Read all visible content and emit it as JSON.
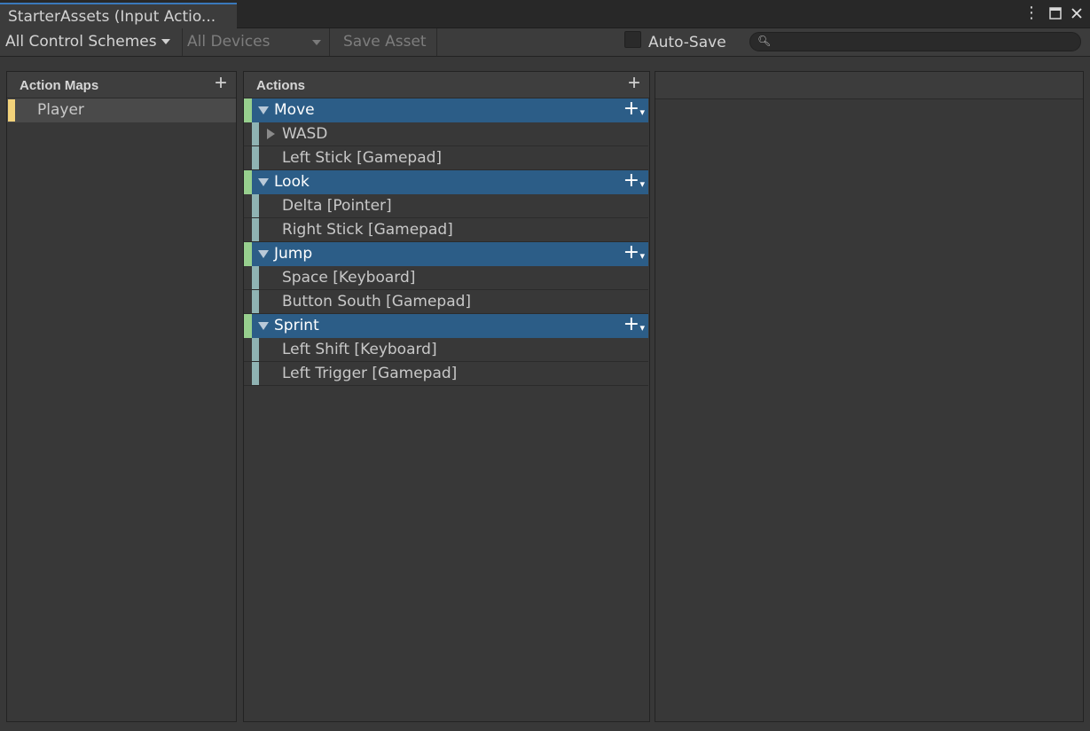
{
  "window": {
    "tab_title": "StarterAssets (Input Actio...",
    "menu_icon": "more-vertical-icon",
    "maximize_icon": "maximize-icon",
    "close_icon": "close-icon"
  },
  "toolbar": {
    "control_schemes": "All Control Schemes",
    "devices": "All Devices",
    "save_asset": "Save Asset",
    "auto_save_label": "Auto-Save",
    "auto_save_checked": false,
    "search_value": "",
    "search_icon": "search-icon"
  },
  "action_maps": {
    "header": "Action Maps",
    "items": [
      {
        "label": "Player",
        "selected": true
      }
    ]
  },
  "actions": {
    "header": "Actions",
    "items": [
      {
        "label": "Move",
        "bindings": [
          {
            "label": "WASD",
            "composite": true
          },
          {
            "label": "Left Stick [Gamepad]"
          }
        ]
      },
      {
        "label": "Look",
        "bindings": [
          {
            "label": "Delta [Pointer]"
          },
          {
            "label": "Right Stick [Gamepad]"
          }
        ]
      },
      {
        "label": "Jump",
        "bindings": [
          {
            "label": "Space [Keyboard]"
          },
          {
            "label": "Button South [Gamepad]"
          }
        ]
      },
      {
        "label": "Sprint",
        "bindings": [
          {
            "label": "Left Shift [Keyboard]"
          },
          {
            "label": "Left Trigger [Gamepad]"
          }
        ]
      }
    ]
  },
  "colors": {
    "action_row": "#2c5d87",
    "action_marker": "#97cf8e",
    "binding_marker": "#8fb3b3",
    "map_marker": "#f2d27a",
    "tab_accent": "#3a79bb"
  }
}
